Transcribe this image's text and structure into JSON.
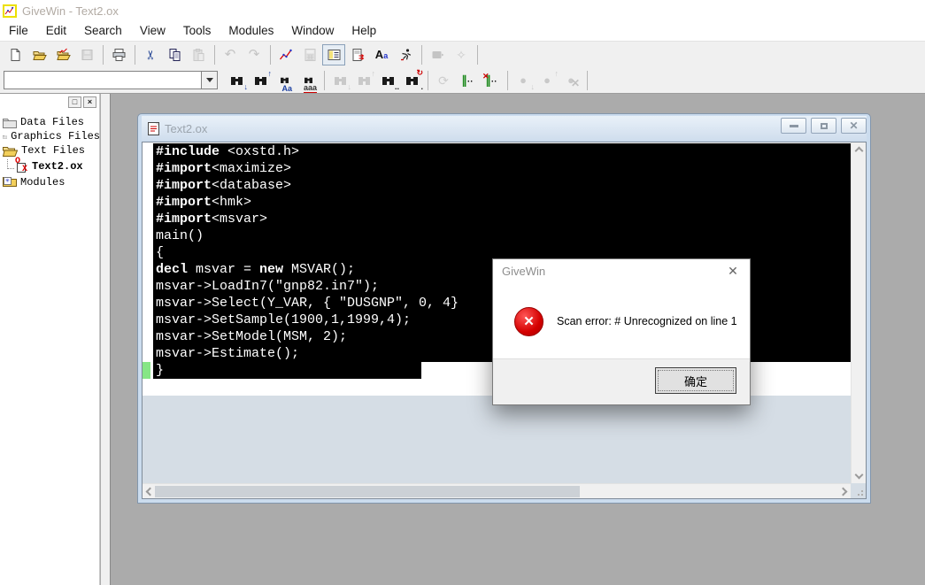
{
  "app": {
    "title": "GiveWin - Text2.ox"
  },
  "menu": {
    "items": [
      "File",
      "Edit",
      "Search",
      "View",
      "Tools",
      "Modules",
      "Window",
      "Help"
    ]
  },
  "toolbar_main": {
    "icons": [
      "new-document",
      "open-file",
      "open-graphics",
      "save",
      "print",
      "cut",
      "copy",
      "paste",
      "undo",
      "redo",
      "graphics",
      "calculator",
      "workspace-toggle",
      "results-document",
      "fonts",
      "run",
      "ox-run",
      "wand"
    ]
  },
  "toolbar_find": {
    "search_combo_value": "",
    "icons": [
      "find-next",
      "find-previous",
      "match-case",
      "whole-word",
      "find-next-disabled",
      "find-previous-disabled",
      "find-in-files",
      "find-replace",
      "rescan",
      "comment-lines",
      "uncomment-lines",
      "bookmark-next",
      "bookmark-previous",
      "bookmark-clear"
    ]
  },
  "sidebar": {
    "panel_buttons": {
      "maximize_glyph": "□",
      "close_glyph": "×"
    },
    "items": [
      {
        "label": "Data Files",
        "icon": "closed-folder"
      },
      {
        "label": "Graphics Files",
        "icon": "closed-folder"
      },
      {
        "label": "Text Files",
        "icon": "open-folder"
      },
      {
        "label": "Text2.ox",
        "icon": "ox-file"
      },
      {
        "label": "Modules",
        "icon": "modules-folder"
      }
    ]
  },
  "editor": {
    "title": "Text2.ox",
    "window_buttons": [
      "minimize",
      "restore",
      "close"
    ],
    "code_lines": [
      {
        "segs": [
          {
            "t": "#include",
            "b": true
          },
          {
            "t": " <oxstd.h>",
            "b": false
          }
        ]
      },
      {
        "segs": [
          {
            "t": "#import",
            "b": true
          },
          {
            "t": "<maximize>",
            "b": false
          }
        ]
      },
      {
        "segs": [
          {
            "t": "#import",
            "b": true
          },
          {
            "t": "<database>",
            "b": false
          }
        ]
      },
      {
        "segs": [
          {
            "t": "#import",
            "b": true
          },
          {
            "t": "<hmk>",
            "b": false
          }
        ]
      },
      {
        "segs": [
          {
            "t": "#import",
            "b": true
          },
          {
            "t": "<msvar>",
            "b": false
          }
        ]
      },
      {
        "segs": [
          {
            "t": "main()",
            "b": false
          }
        ]
      },
      {
        "segs": [
          {
            "t": "{",
            "b": false
          }
        ]
      },
      {
        "segs": [
          {
            "t": "decl",
            "b": true
          },
          {
            "t": " msvar = ",
            "b": false
          },
          {
            "t": "new",
            "b": true
          },
          {
            "t": " MSVAR();",
            "b": false
          }
        ]
      },
      {
        "segs": [
          {
            "t": "msvar->LoadIn7(\"gnp82.in7\");",
            "b": false
          }
        ]
      },
      {
        "segs": [
          {
            "t": "msvar->Select(Y_VAR, { \"DUSGNP\", 0, 4}",
            "b": false
          }
        ]
      },
      {
        "segs": [
          {
            "t": "msvar->SetSample(1900,1,1999,4);",
            "b": false
          }
        ]
      },
      {
        "segs": [
          {
            "t": "msvar->SetModel(MSM, 2);",
            "b": false
          }
        ]
      },
      {
        "segs": [
          {
            "t": "msvar->Estimate();",
            "b": false
          }
        ]
      },
      {
        "segs": [
          {
            "t": "}",
            "b": false
          }
        ],
        "last": true
      }
    ]
  },
  "dialog": {
    "title": "GiveWin",
    "close_glyph": "✕",
    "error_glyph": "✕",
    "message": "Scan error: # Unrecognized on line 1",
    "ok_label": "确定"
  },
  "colors": {
    "error_red": "#d40000",
    "mdi_background": "#ababab",
    "caret_marker_green": "#86e686",
    "selection_bg": "#000000",
    "selection_fg": "#ffffff"
  }
}
